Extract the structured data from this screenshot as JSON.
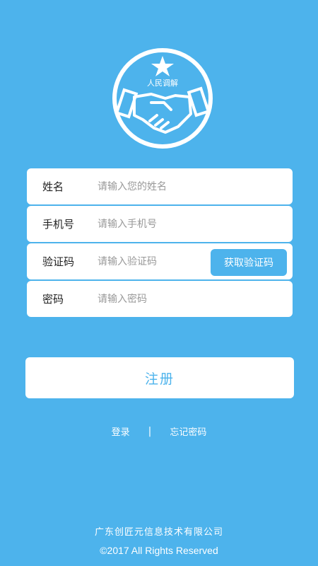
{
  "logo": {
    "text": "人民调解",
    "icon": "handshake-star-logo"
  },
  "form": {
    "fields": [
      {
        "label": "姓名",
        "placeholder": "请输入您的姓名",
        "value": ""
      },
      {
        "label": "手机号",
        "placeholder": "请输入手机号",
        "value": ""
      },
      {
        "label": "验证码",
        "placeholder": "请输入验证码",
        "value": ""
      },
      {
        "label": "密码",
        "placeholder": "请输入密码",
        "value": ""
      }
    ],
    "get_code_label": "获取验证码"
  },
  "register_label": "注册",
  "links": {
    "login": "登录",
    "separator": "|",
    "forgot": "忘记密码"
  },
  "footer": {
    "company": "广东创匠元信息技术有限公司",
    "copyright": "©2017 All Rights Reserved"
  },
  "colors": {
    "background": "#4DB3EC",
    "card": "#FFFFFF",
    "accent": "#4DB3EC"
  }
}
